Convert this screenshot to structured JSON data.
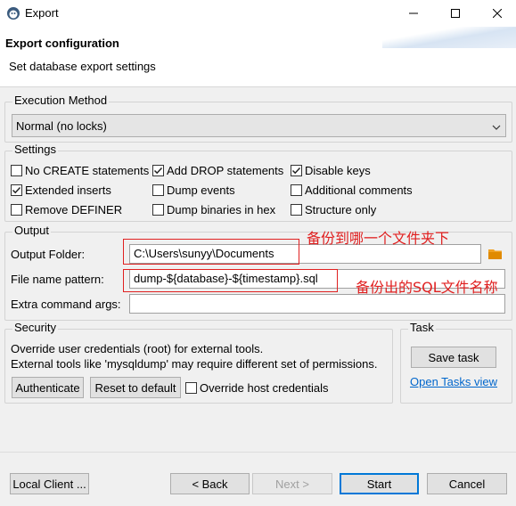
{
  "window": {
    "title": "Export",
    "icon": "dbeaver-beaver-icon",
    "controls": [
      "minimize-icon",
      "maximize-icon",
      "close-icon"
    ]
  },
  "header": {
    "title": "Export configuration",
    "subtitle": "Set database export settings"
  },
  "execution_method": {
    "legend": "Execution Method",
    "selected": "Normal (no locks)"
  },
  "settings": {
    "legend": "Settings",
    "options": [
      {
        "label": "No CREATE statements",
        "checked": false
      },
      {
        "label": "Add DROP statements",
        "checked": true
      },
      {
        "label": "Disable keys",
        "checked": true
      },
      {
        "label": "Extended inserts",
        "checked": true
      },
      {
        "label": "Dump events",
        "checked": false
      },
      {
        "label": "Additional comments",
        "checked": false
      },
      {
        "label": "Remove DEFINER",
        "checked": false
      },
      {
        "label": "Dump binaries in hex",
        "checked": false
      },
      {
        "label": "Structure only",
        "checked": false
      }
    ]
  },
  "output": {
    "legend": "Output",
    "folder_label": "Output Folder:",
    "folder_value": "C:\\Users\\sunyy\\Documents",
    "folder_annotation": "备份到哪一个文件夹下",
    "pattern_label": "File name pattern:",
    "pattern_value": "dump-${database}-${timestamp}.sql",
    "pattern_annotation": "备份出的SQL文件名称",
    "extra_label": "Extra command args:",
    "extra_value": "",
    "folder_icon": "folder-icon",
    "annotation_color": "#e02020"
  },
  "security": {
    "legend": "Security",
    "line1": "Override user credentials (root) for external tools.",
    "line2": "External tools like 'mysqldump' may require different set of permissions.",
    "authenticate_label": "Authenticate",
    "reset_label": "Reset to default",
    "override_host_label": "Override host credentials",
    "override_host_checked": false
  },
  "task": {
    "legend": "Task",
    "save_label": "Save task",
    "open_tasks_label": "Open Tasks view"
  },
  "footer": {
    "local_client_label": "Local Client ...",
    "back_label": "< Back",
    "next_label": "Next >",
    "start_label": "Start",
    "cancel_label": "Cancel"
  }
}
